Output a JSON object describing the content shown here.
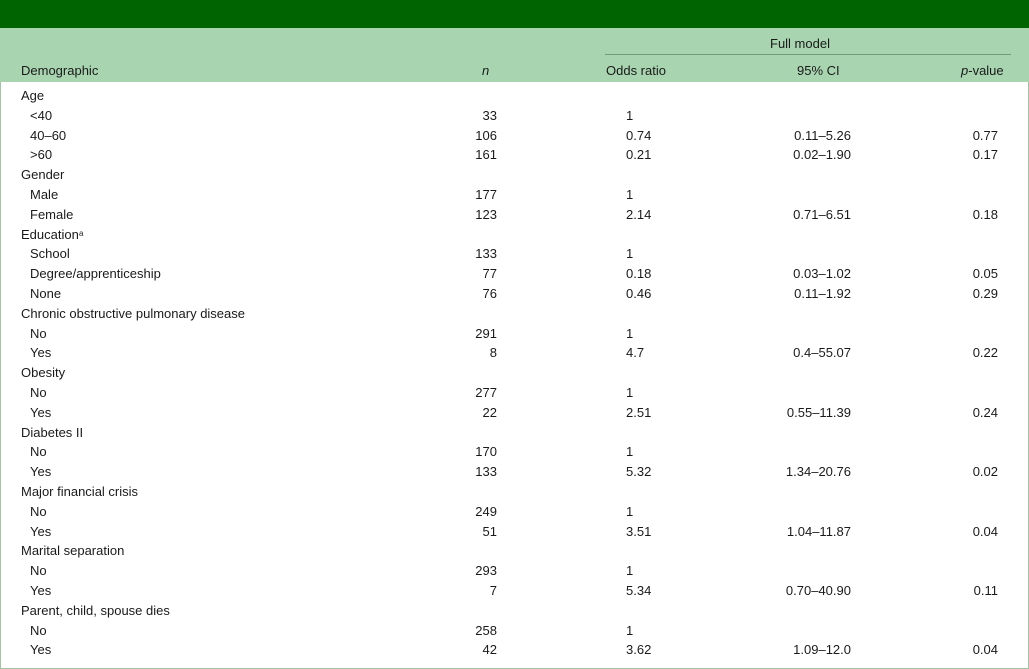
{
  "table": {
    "group_header": "Full model",
    "columns": {
      "demographic": "Demographic",
      "n": "n",
      "odds_ratio": "Odds ratio",
      "ci": "95% CI",
      "p_italic": "p",
      "p_rest": "-value"
    },
    "rows": [
      {
        "label": "Age",
        "type": "category",
        "sup": ""
      },
      {
        "label": "<40",
        "type": "level",
        "n": "33",
        "or": "1",
        "ci": "",
        "p": ""
      },
      {
        "label": "40–60",
        "type": "level",
        "n": "106",
        "or": "0.74",
        "ci": "0.11–5.26",
        "p": "0.77"
      },
      {
        "label": ">60",
        "type": "level",
        "n": "161",
        "or": "0.21",
        "ci": "0.02–1.90",
        "p": "0.17"
      },
      {
        "label": "Gender",
        "type": "category",
        "sup": ""
      },
      {
        "label": "Male",
        "type": "level",
        "n": "177",
        "or": "1",
        "ci": "",
        "p": ""
      },
      {
        "label": "Female",
        "type": "level",
        "n": "123",
        "or": "2.14",
        "ci": "0.71–6.51",
        "p": "0.18"
      },
      {
        "label": "Education",
        "type": "category",
        "sup": "a"
      },
      {
        "label": "School",
        "type": "level",
        "n": "133",
        "or": "1",
        "ci": "",
        "p": ""
      },
      {
        "label": "Degree/apprenticeship",
        "type": "level",
        "n": "77",
        "or": "0.18",
        "ci": "0.03–1.02",
        "p": "0.05"
      },
      {
        "label": "None",
        "type": "level",
        "n": "76",
        "or": "0.46",
        "ci": "0.11–1.92",
        "p": "0.29"
      },
      {
        "label": "Chronic obstructive pulmonary disease",
        "type": "category",
        "sup": ""
      },
      {
        "label": "No",
        "type": "level",
        "n": "291",
        "or": "1",
        "ci": "",
        "p": ""
      },
      {
        "label": "Yes",
        "type": "level",
        "n": "8",
        "or": "4.7",
        "ci": "0.4–55.07",
        "p": "0.22"
      },
      {
        "label": "Obesity",
        "type": "category",
        "sup": ""
      },
      {
        "label": "No",
        "type": "level",
        "n": "277",
        "or": "1",
        "ci": "",
        "p": ""
      },
      {
        "label": "Yes",
        "type": "level",
        "n": "22",
        "or": "2.51",
        "ci": "0.55–11.39",
        "p": "0.24"
      },
      {
        "label": "Diabetes II",
        "type": "category",
        "sup": ""
      },
      {
        "label": "No",
        "type": "level",
        "n": "170",
        "or": "1",
        "ci": "",
        "p": ""
      },
      {
        "label": "Yes",
        "type": "level",
        "n": "133",
        "or": "5.32",
        "ci": "1.34–20.76",
        "p": "0.02"
      },
      {
        "label": "Major financial crisis",
        "type": "category",
        "sup": ""
      },
      {
        "label": "No",
        "type": "level",
        "n": "249",
        "or": "1",
        "ci": "",
        "p": ""
      },
      {
        "label": "Yes",
        "type": "level",
        "n": "51",
        "or": "3.51",
        "ci": "1.04–11.87",
        "p": "0.04"
      },
      {
        "label": "Marital separation",
        "type": "category",
        "sup": ""
      },
      {
        "label": "No",
        "type": "level",
        "n": "293",
        "or": "1",
        "ci": "",
        "p": ""
      },
      {
        "label": "Yes",
        "type": "level",
        "n": "7",
        "or": "5.34",
        "ci": "0.70–40.90",
        "p": "0.11"
      },
      {
        "label": "Parent, child, spouse dies",
        "type": "category",
        "sup": ""
      },
      {
        "label": "No",
        "type": "level",
        "n": "258",
        "or": "1",
        "ci": "",
        "p": ""
      },
      {
        "label": "Yes",
        "type": "level",
        "n": "42",
        "or": "3.62",
        "ci": "1.09–12.0",
        "p": "0.04"
      }
    ]
  }
}
